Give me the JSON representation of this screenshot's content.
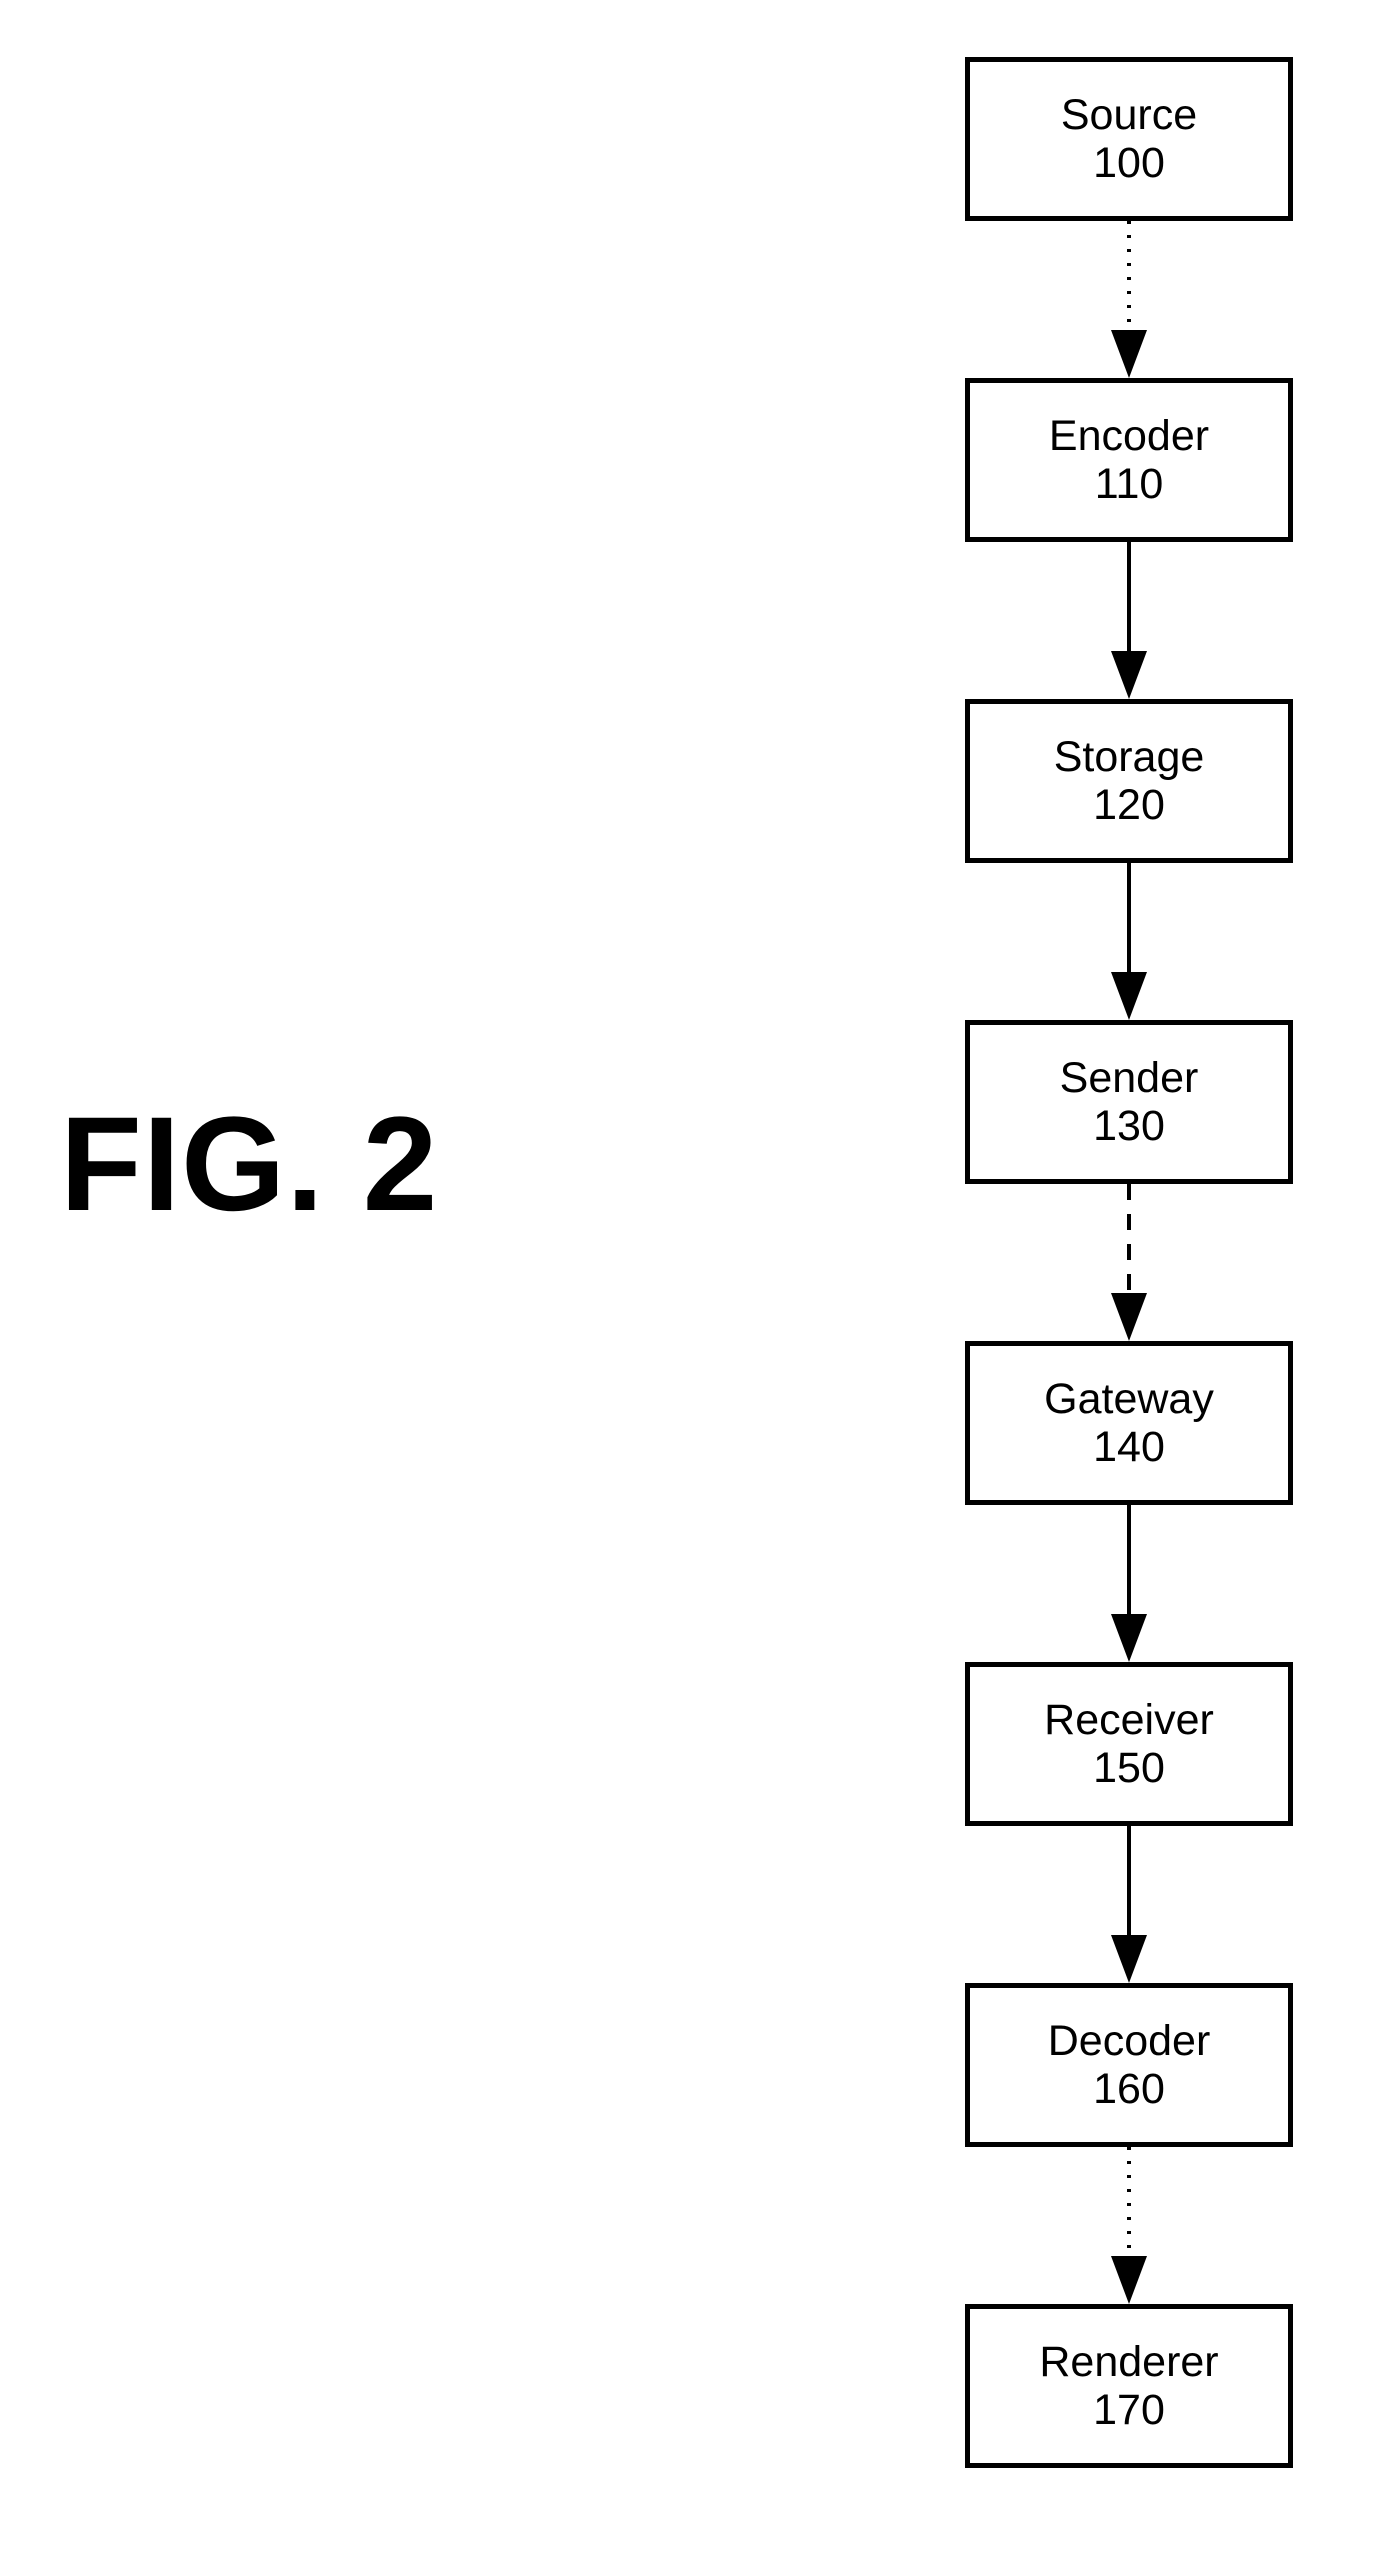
{
  "figure": {
    "caption": "FIG. 2",
    "colors": {
      "ink": "#000000",
      "background": "#ffffff"
    }
  },
  "flow": {
    "nodes": [
      {
        "label": "Source",
        "ref": "100"
      },
      {
        "label": "Encoder",
        "ref": "110"
      },
      {
        "label": "Storage",
        "ref": "120"
      },
      {
        "label": "Sender",
        "ref": "130"
      },
      {
        "label": "Gateway",
        "ref": "140"
      },
      {
        "label": "Receiver",
        "ref": "150"
      },
      {
        "label": "Decoder",
        "ref": "160"
      },
      {
        "label": "Renderer",
        "ref": "170"
      }
    ],
    "connectors": [
      {
        "from": "Source",
        "to": "Encoder",
        "style": "dotted"
      },
      {
        "from": "Encoder",
        "to": "Storage",
        "style": "solid"
      },
      {
        "from": "Storage",
        "to": "Sender",
        "style": "solid"
      },
      {
        "from": "Sender",
        "to": "Gateway",
        "style": "dashed"
      },
      {
        "from": "Gateway",
        "to": "Receiver",
        "style": "solid"
      },
      {
        "from": "Receiver",
        "to": "Decoder",
        "style": "solid"
      },
      {
        "from": "Decoder",
        "to": "Renderer",
        "style": "dotted"
      }
    ]
  }
}
